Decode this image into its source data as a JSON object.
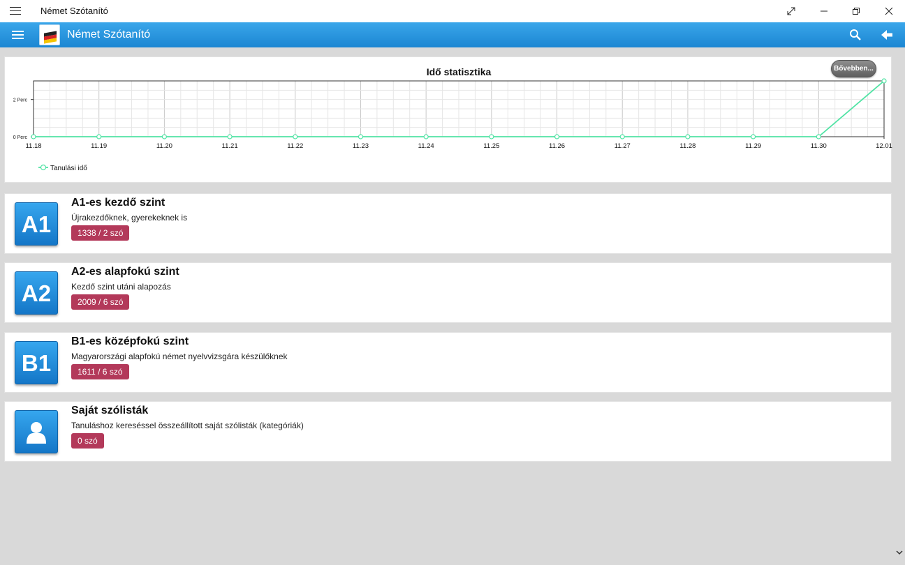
{
  "window": {
    "title": "Német Szótanító",
    "controls": [
      "fullscreen-icon",
      "minimize-icon",
      "restore-icon",
      "close-icon"
    ]
  },
  "appbar": {
    "title": "Német Szótanító",
    "icons": [
      "menu-icon",
      "app-logo",
      "search-icon",
      "back-arrow-icon"
    ]
  },
  "stats": {
    "more_label": "Bővebben...",
    "chart_data": {
      "type": "line",
      "title": "Idő statisztika",
      "categories": [
        "11.18",
        "11.19",
        "11.20",
        "11.21",
        "11.22",
        "11.23",
        "11.24",
        "11.25",
        "11.26",
        "11.27",
        "11.28",
        "11.29",
        "11.30",
        "12.01"
      ],
      "y_ticks": [
        "0 Perc",
        "2 Perc"
      ],
      "series": [
        {
          "name": "Tanulási idő",
          "values": [
            0,
            0,
            0,
            0,
            0,
            0,
            0,
            0,
            0,
            0,
            0,
            0,
            0,
            3
          ],
          "color": "#50e3a4"
        }
      ],
      "ylim": [
        0,
        3
      ],
      "grid": true,
      "legend": "bottom-left"
    }
  },
  "levels": [
    {
      "tile": "A1",
      "title": "A1-es kezdő szint",
      "subtitle": "Újrakezdőknek, gyerekeknek is",
      "badge": "1338 / 2 szó"
    },
    {
      "tile": "A2",
      "title": "A2-es alapfokú szint",
      "subtitle": "Kezdő szint utáni alapozás",
      "badge": "2009 / 6 szó"
    },
    {
      "tile": "B1",
      "title": "B1-es középfokú szint",
      "subtitle": "Magyarországi alapfokú német nyelvvizsgára készülőknek",
      "badge": "1611 / 6 szó"
    }
  ],
  "custom": {
    "title": "Saját szólisták",
    "subtitle": "Tanuláshoz kereséssel összeállított saját szólisták (kategóriák)",
    "badge": "0 szó",
    "icon": "user-icon"
  },
  "colors": {
    "accent": "#1b86d2",
    "badge": "#b3395a",
    "line": "#50e3a4"
  }
}
